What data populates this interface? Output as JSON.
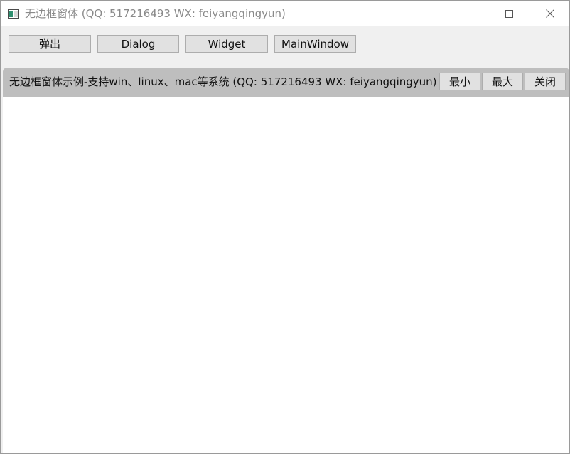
{
  "window": {
    "title": "无边框窗体 (QQ: 517216493 WX: feiyangqingyun)",
    "controls": [
      "minimize",
      "maximize",
      "close"
    ]
  },
  "toolbar": {
    "buttons": [
      "弹出",
      "Dialog",
      "Widget",
      "MainWindow"
    ]
  },
  "inner_window": {
    "title": "无边框窗体示例-支持win、linux、mac等系统 (QQ: 517216493 WX: feiyangqingyun)",
    "buttons": [
      "最小",
      "最大",
      "关闭"
    ]
  },
  "colors": {
    "inner_titlebar": "#bebebe",
    "button_face": "#e1e1e1",
    "button_border": "#adadad"
  }
}
